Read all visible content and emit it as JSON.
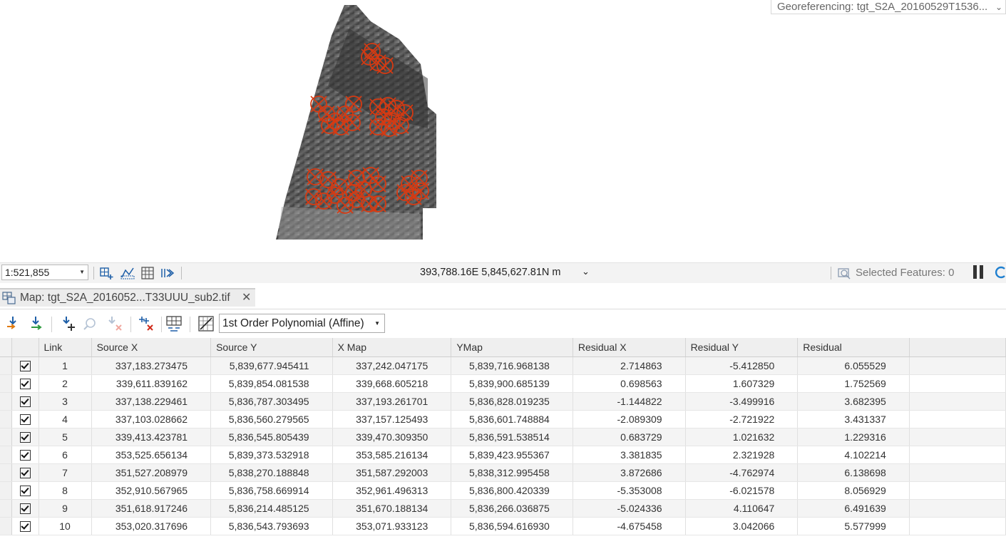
{
  "map": {
    "georef_dropdown": "Georeferencing: tgt_S2A_20160529T1536..."
  },
  "status_bar": {
    "scale": "1:521,855",
    "coordinates": "393,788.16E 5,845,627.81N m",
    "selected_features": "Selected Features: 0"
  },
  "pane_tab": {
    "label": "Map: tgt_S2A_2016052...T33UUU_sub2.tif"
  },
  "toolbar": {
    "transformation": "1st Order Polynomial (Affine)"
  },
  "table": {
    "columns": [
      "Link",
      "Source X",
      "Source Y",
      "X Map",
      "YMap",
      "Residual X",
      "Residual Y",
      "Residual"
    ],
    "rows": [
      {
        "checked": true,
        "link": "1",
        "source_x": "337,183.273475",
        "source_y": "5,839,677.945411",
        "x_map": "337,242.047175",
        "y_map": "5,839,716.968138",
        "res_x": "2.714863",
        "res_y": "-5.412850",
        "residual": "6.055529"
      },
      {
        "checked": true,
        "link": "2",
        "source_x": "339,611.839162",
        "source_y": "5,839,854.081538",
        "x_map": "339,668.605218",
        "y_map": "5,839,900.685139",
        "res_x": "0.698563",
        "res_y": "1.607329",
        "residual": "1.752569"
      },
      {
        "checked": true,
        "link": "3",
        "source_x": "337,138.229461",
        "source_y": "5,836,787.303495",
        "x_map": "337,193.261701",
        "y_map": "5,836,828.019235",
        "res_x": "-1.144822",
        "res_y": "-3.499916",
        "residual": "3.682395"
      },
      {
        "checked": true,
        "link": "4",
        "source_x": "337,103.028662",
        "source_y": "5,836,560.279565",
        "x_map": "337,157.125493",
        "y_map": "5,836,601.748884",
        "res_x": "-2.089309",
        "res_y": "-2.721922",
        "residual": "3.431337"
      },
      {
        "checked": true,
        "link": "5",
        "source_x": "339,413.423781",
        "source_y": "5,836,545.805439",
        "x_map": "339,470.309350",
        "y_map": "5,836,591.538514",
        "res_x": "0.683729",
        "res_y": "1.021632",
        "residual": "1.229316"
      },
      {
        "checked": true,
        "link": "6",
        "source_x": "353,525.656134",
        "source_y": "5,839,373.532918",
        "x_map": "353,585.216134",
        "y_map": "5,839,423.955367",
        "res_x": "3.381835",
        "res_y": "2.321928",
        "residual": "4.102214"
      },
      {
        "checked": true,
        "link": "7",
        "source_x": "351,527.208979",
        "source_y": "5,838,270.188848",
        "x_map": "351,587.292003",
        "y_map": "5,838,312.995458",
        "res_x": "3.872686",
        "res_y": "-4.762974",
        "residual": "6.138698"
      },
      {
        "checked": true,
        "link": "8",
        "source_x": "352,910.567965",
        "source_y": "5,836,758.669914",
        "x_map": "352,961.496313",
        "y_map": "5,836,800.420339",
        "res_x": "-5.353008",
        "res_y": "-6.021578",
        "residual": "8.056929"
      },
      {
        "checked": true,
        "link": "9",
        "source_x": "351,618.917246",
        "source_y": "5,836,214.485125",
        "x_map": "351,670.188134",
        "y_map": "5,836,266.036875",
        "res_x": "-5.024336",
        "res_y": "4.110647",
        "residual": "6.491639"
      },
      {
        "checked": true,
        "link": "10",
        "source_x": "353,020.317696",
        "source_y": "5,836,543.793693",
        "x_map": "353,071.933123",
        "y_map": "5,836,594.616930",
        "res_x": "-4.675458",
        "res_y": "3.042066",
        "residual": "5.577999"
      }
    ]
  },
  "icons": [
    "add-control-points-icon",
    "auto-georeference-icon",
    "add-point-icon",
    "zoom-to-point-icon",
    "delete-point-icon",
    "delete-all-points-icon",
    "link-table-icon",
    "transformation-icon",
    "grid-icon",
    "pause-icon",
    "refresh-icon"
  ],
  "colors": {
    "control_point": "#d63a12",
    "raster_dark": "#3a3a3a",
    "raster_light": "#9a9a9a"
  }
}
